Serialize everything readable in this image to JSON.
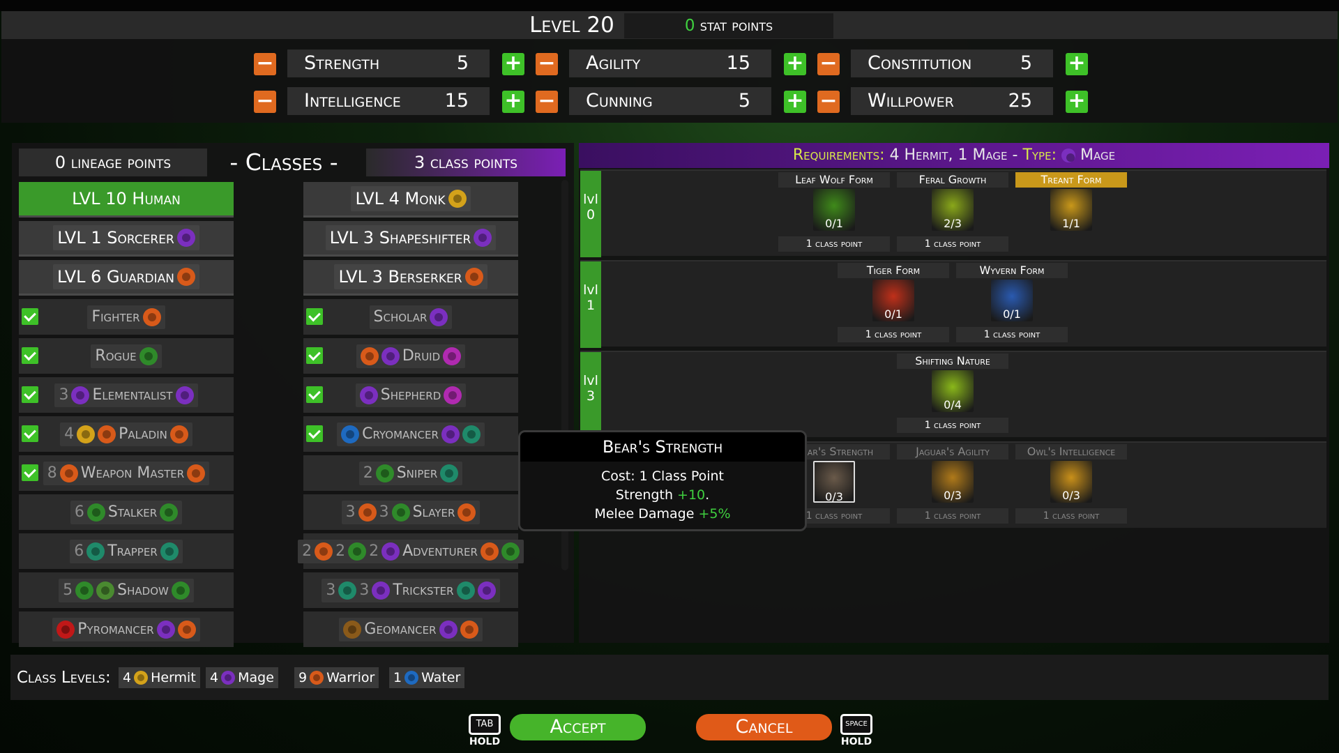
{
  "header": {
    "level_label": "Level 20",
    "stat_points_count": "0",
    "stat_points_label": "stat points"
  },
  "stats": [
    {
      "name": "Strength",
      "value": "5"
    },
    {
      "name": "Agility",
      "value": "15"
    },
    {
      "name": "Constitution",
      "value": "5"
    },
    {
      "name": "Intelligence",
      "value": "15"
    },
    {
      "name": "Cunning",
      "value": "5"
    },
    {
      "name": "Willpower",
      "value": "25"
    }
  ],
  "buttons": {
    "minus": "−",
    "plus": "+"
  },
  "classes_panel": {
    "lineage_points": "0 lineage points",
    "title": "- Classes -",
    "class_points": "3 class points",
    "cells": [
      {
        "label": "LVL 10 Human",
        "icons": [],
        "pre": "",
        "checked": false,
        "kind": "lvl human"
      },
      {
        "label": "LVL 4 Monk",
        "icons": [
          "hermit"
        ],
        "pre": "",
        "checked": false,
        "kind": "lvl"
      },
      {
        "label": "LVL 1 Sorcerer",
        "icons": [
          "mage"
        ],
        "pre": "",
        "checked": false,
        "kind": "lvl"
      },
      {
        "label": "LVL 3 Shapeshifter",
        "icons": [
          "mage"
        ],
        "pre": "",
        "checked": false,
        "kind": "lvl"
      },
      {
        "label": "LVL 6 Guardian",
        "icons": [
          "warrior"
        ],
        "pre": "",
        "checked": false,
        "kind": "lvl"
      },
      {
        "label": "LVL 3 Berserker",
        "icons": [
          "warrior"
        ],
        "pre": "",
        "checked": false,
        "kind": "lvl"
      },
      {
        "label": "Fighter",
        "icons": [
          "warrior"
        ],
        "pre": "",
        "checked": true,
        "kind": ""
      },
      {
        "label": "Scholar",
        "icons": [
          "mage"
        ],
        "pre": "",
        "checked": true,
        "kind": ""
      },
      {
        "label": "Rogue",
        "icons": [
          "rogue"
        ],
        "pre": "",
        "checked": true,
        "kind": ""
      },
      {
        "label": "Druid",
        "icons": [
          "heart"
        ],
        "pre": "",
        "checked": true,
        "kind": "",
        "pre_icons": [
          "warrior",
          "mage"
        ]
      },
      {
        "label": "Elementalist",
        "icons": [
          "mage"
        ],
        "pre": "3",
        "checked": true,
        "kind": "",
        "pre_icons": [
          "mage"
        ]
      },
      {
        "label": "Shepherd",
        "icons": [
          "heart"
        ],
        "pre": "",
        "checked": true,
        "kind": "",
        "pre_icons": [
          "mage"
        ]
      },
      {
        "label": "Paladin",
        "icons": [
          "warrior"
        ],
        "pre": "4",
        "checked": true,
        "kind": "",
        "pre_icons": [
          "hermit",
          "warrior"
        ]
      },
      {
        "label": "Cryomancer",
        "icons": [
          "mage",
          "nature"
        ],
        "pre": "",
        "checked": true,
        "kind": "",
        "pre_icons": [
          "water"
        ]
      },
      {
        "label": "Weapon Master",
        "icons": [
          "warrior"
        ],
        "pre": "8",
        "checked": true,
        "kind": "",
        "pre_icons": [
          "warrior"
        ]
      },
      {
        "label": "Sniper",
        "icons": [
          "nature"
        ],
        "pre": "2",
        "checked": false,
        "kind": "",
        "pre_icons": [
          "rogue"
        ]
      },
      {
        "label": "Stalker",
        "icons": [
          "rogue"
        ],
        "pre": "6",
        "checked": false,
        "kind": "",
        "pre_icons": [
          "rogue"
        ]
      },
      {
        "label": "Slayer",
        "icons": [
          "warrior"
        ],
        "pre": "3  3",
        "checked": false,
        "kind": "",
        "pre_icons": [
          "warrior",
          "rogue"
        ]
      },
      {
        "label": "Trapper",
        "icons": [
          "nature"
        ],
        "pre": "6",
        "checked": false,
        "kind": "",
        "pre_icons": [
          "nature"
        ]
      },
      {
        "label": "Adventurer",
        "icons": [
          "warrior",
          "rogue"
        ],
        "pre": "2  2  2",
        "checked": false,
        "kind": "",
        "pre_icons": [
          "warrior",
          "rogue",
          "mage"
        ]
      },
      {
        "label": "Shadow",
        "icons": [
          "rogue"
        ],
        "pre": "5",
        "checked": false,
        "kind": "",
        "pre_icons": [
          "rogue",
          "wheel"
        ]
      },
      {
        "label": "Trickster",
        "icons": [
          "nature",
          "mage"
        ],
        "pre": "3  3",
        "checked": false,
        "kind": "",
        "pre_icons": [
          "nature",
          "mage"
        ]
      },
      {
        "label": "Pyromancer",
        "icons": [
          "mage",
          "warrior"
        ],
        "pre": "",
        "checked": false,
        "kind": "",
        "pre_icons": [
          "fire"
        ]
      },
      {
        "label": "Geomancer",
        "icons": [
          "mage",
          "warrior"
        ],
        "pre": "",
        "checked": false,
        "kind": "",
        "pre_icons": [
          "earth"
        ]
      }
    ]
  },
  "requirements": {
    "label": "Requirements:",
    "text": "4 Hermit, 1 Mage - ",
    "type_label": "Type:",
    "type_value": "Mage"
  },
  "tiers": [
    {
      "tag": "lvl 0",
      "nodes": [
        {
          "title": "Leaf Wolf Form",
          "progress": "0/1",
          "cost": "1 class point",
          "active": false,
          "color": "#3f8a1a"
        },
        {
          "title": "Feral Growth",
          "progress": "2/3",
          "cost": "1 class point",
          "active": false,
          "color": "#8aa81a"
        },
        {
          "title": "Treant Form",
          "progress": "1/1",
          "cost": "",
          "active": true,
          "color": "#c9981a"
        }
      ]
    },
    {
      "tag": "lvl 1",
      "nodes": [
        {
          "title": "Tiger Form",
          "progress": "0/1",
          "cost": "1 class point",
          "active": false,
          "color": "#c0301a"
        },
        {
          "title": "Wyvern Form",
          "progress": "0/1",
          "cost": "1 class point",
          "active": false,
          "color": "#2a5ab0"
        }
      ]
    },
    {
      "tag": "lvl 3",
      "nodes": [
        {
          "title": "Shifting Nature",
          "progress": "0/4",
          "cost": "1 class point",
          "active": false,
          "color": "#8ab81a"
        }
      ]
    },
    {
      "tag": "lvl 5",
      "nodes": [
        {
          "title": "Bear's Strength",
          "progress": "0/3",
          "cost": "1 class point",
          "active": false,
          "color": "#6a5a4a"
        },
        {
          "title": "Jaguar's Agility",
          "progress": "0/3",
          "cost": "1 class point",
          "active": false,
          "color": "#b07a1a"
        },
        {
          "title": "Owl's Intelligence",
          "progress": "0/3",
          "cost": "1 class point",
          "active": false,
          "color": "#c9901a"
        }
      ]
    }
  ],
  "tooltip": {
    "title": "Bear's Strength",
    "cost": "Cost: 1 Class Point",
    "line1_label": "Strength ",
    "line1_value": "+10",
    "line2_label": "Melee Damage ",
    "line2_value": "+5%"
  },
  "class_levels": {
    "label": "Class Levels:",
    "chips": [
      {
        "count": "4",
        "name": "Hermit",
        "icon": "hermit"
      },
      {
        "count": "4",
        "name": "Mage",
        "icon": "mage"
      },
      {
        "count": "9",
        "name": "Warrior",
        "icon": "warrior"
      },
      {
        "count": "1",
        "name": "Water",
        "icon": "water"
      }
    ]
  },
  "actions": {
    "accept": "Accept",
    "cancel": "Cancel",
    "tab_key": "TAB",
    "space_key": "SPACE",
    "hold": "HOLD"
  }
}
